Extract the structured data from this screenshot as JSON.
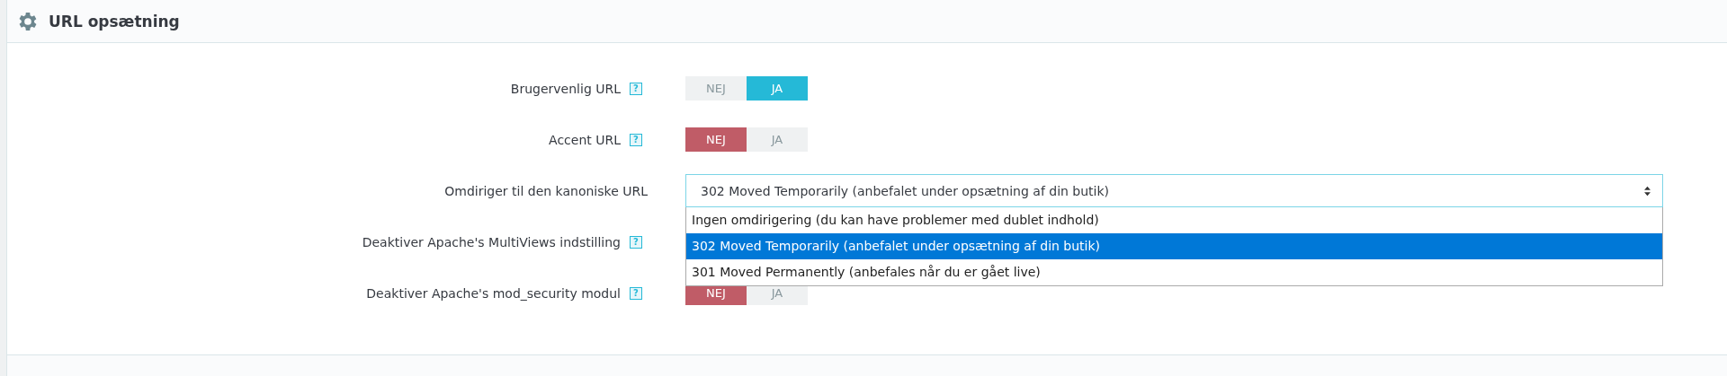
{
  "panel": {
    "title": "URL opsætning"
  },
  "rows": [
    {
      "label": "Brugervenlig URL",
      "help": "?",
      "kind": "toggle",
      "options": [
        {
          "label": "NEJ",
          "kind": "off",
          "selected": false
        },
        {
          "label": "JA",
          "kind": "on",
          "selected": true
        }
      ]
    },
    {
      "label": "Accent URL",
      "help": "?",
      "kind": "toggle",
      "options": [
        {
          "label": "NEJ",
          "kind": "off",
          "selected": true
        },
        {
          "label": "JA",
          "kind": "on",
          "selected": false
        }
      ]
    },
    {
      "label": "Omdiriger til den kanoniske URL",
      "kind": "select",
      "value": "302 Moved Temporarily (anbefalet under opsætning af din butik)",
      "expanded": true,
      "options": [
        {
          "label": "Ingen omdirigering (du kan have problemer med dublet indhold)",
          "selected": false
        },
        {
          "label": "302 Moved Temporarily (anbefalet under opsætning af din butik)",
          "selected": true
        },
        {
          "label": "301 Moved Permanently (anbefales når du er gået live)",
          "selected": false
        }
      ]
    },
    {
      "label": "Deaktiver Apache's MultiViews indstilling",
      "help": "?",
      "kind": "hidden"
    },
    {
      "label": "Deaktiver Apache's mod_security modul",
      "help": "?",
      "kind": "toggle",
      "options": [
        {
          "label": "NEJ",
          "kind": "off",
          "selected": true
        },
        {
          "label": "JA",
          "kind": "on",
          "selected": false
        }
      ]
    }
  ]
}
